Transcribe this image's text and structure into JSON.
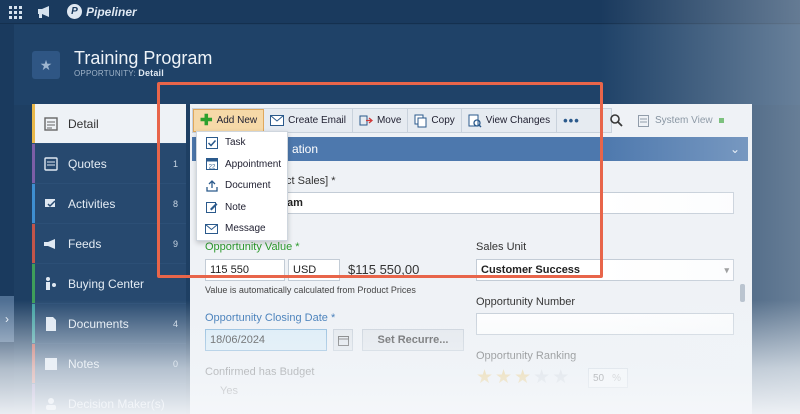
{
  "topbar": {
    "brand": "Pipeliner",
    "brand_mark": "P"
  },
  "header": {
    "title": "Training Program",
    "subtitle_prefix": "OPPORTUNITY: ",
    "subtitle_detail": "Detail"
  },
  "sidebar": {
    "items": [
      {
        "label": "Detail",
        "count": "",
        "icon": "detail-icon",
        "accent": "#e8b84a"
      },
      {
        "label": "Quotes",
        "count": "1",
        "icon": "quotes-icon",
        "accent": "#7b5ea7"
      },
      {
        "label": "Activities",
        "count": "8",
        "icon": "activities-icon",
        "accent": "#3e8ed0"
      },
      {
        "label": "Feeds",
        "count": "9",
        "icon": "feeds-icon",
        "accent": "#c2554a"
      },
      {
        "label": "Buying Center",
        "count": "",
        "icon": "buying-center-icon",
        "accent": "#3e9e5a"
      },
      {
        "label": "Documents",
        "count": "4",
        "icon": "documents-icon",
        "accent": "#3ea0a0"
      },
      {
        "label": "Notes",
        "count": "0",
        "icon": "notes-icon",
        "accent": "#c2554a"
      },
      {
        "label": "Decision Maker(s)",
        "count": "",
        "icon": "decision-maker-icon",
        "accent": "#7b5ea7"
      }
    ]
  },
  "toolbar": {
    "add_new": "Add New",
    "create_email": "Create Email",
    "move": "Move",
    "copy": "Copy",
    "view_changes": "View Changes",
    "more": "•••",
    "system_view": "System View"
  },
  "dropdown": {
    "items": [
      {
        "label": "Task",
        "icon": "task-icon"
      },
      {
        "label": "Appointment",
        "icon": "appointment-icon"
      },
      {
        "label": "Document",
        "icon": "document-icon"
      },
      {
        "label": "Note",
        "icon": "note-icon"
      },
      {
        "label": "Message",
        "icon": "message-icon"
      }
    ]
  },
  "section": {
    "title": "ation"
  },
  "form": {
    "name_label": "ct Sales] *",
    "name_value": "am",
    "opp_value_label": "Opportunity Value *",
    "opp_value_amount": "115 550",
    "opp_value_currency": "USD",
    "opp_value_display": "$115 550,00",
    "opp_value_note": "Value is automatically calculated from Product Prices",
    "sales_unit_label": "Sales Unit",
    "sales_unit_value": "Customer Success",
    "closing_date_label": "Opportunity Closing Date *",
    "closing_date_value": "18/06/2024",
    "set_recurrence": "Set Recurre...",
    "opp_number_label": "Opportunity Number",
    "opp_ranking_label": "Opportunity Ranking",
    "ranking_stars": 3,
    "ranking_stars_max": 5,
    "ranking_value": "50",
    "ranking_unit": "%",
    "budget_label": "Confirmed has Budget",
    "budget_value": "Yes"
  },
  "colors": {
    "highlight": "#e8654a",
    "add_new_bg": "#f6d9a8",
    "section_head": "#4d78ad",
    "required_label": "#2d9a2d"
  }
}
